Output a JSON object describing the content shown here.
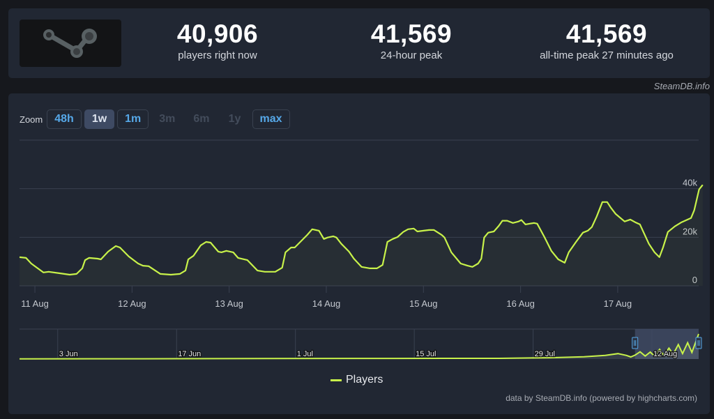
{
  "stats": [
    {
      "value": "40,906",
      "label": "players right now"
    },
    {
      "value": "41,569",
      "label": "24-hour peak"
    },
    {
      "value": "41,569",
      "label": "all-time peak 27 minutes ago"
    }
  ],
  "logo": {
    "icon": "steam-logo-icon"
  },
  "credit_top": "SteamDB.info",
  "zoom": {
    "label": "Zoom",
    "buttons": [
      {
        "label": "48h",
        "state": "enabled"
      },
      {
        "label": "1w",
        "state": "active"
      },
      {
        "label": "1m",
        "state": "enabled"
      },
      {
        "label": "3m",
        "state": "disabled"
      },
      {
        "label": "6m",
        "state": "disabled"
      },
      {
        "label": "1y",
        "state": "disabled"
      },
      {
        "label": "max",
        "state": "enabled"
      }
    ]
  },
  "legend": {
    "label": "Players"
  },
  "credit_bottom": "data by SteamDB.info (powered by highcharts.com)",
  "colors": {
    "line": "#c8f24a",
    "grid": "#3a4150",
    "axis_text": "#c4c8cf",
    "nav_mask": "#3e4a63"
  },
  "chart_data": {
    "type": "line",
    "title": "",
    "xlabel": "",
    "ylabel": "",
    "series": [
      {
        "name": "Players",
        "color": "#c8f24a"
      }
    ],
    "x_unit": "hours since 11 Aug 00:00",
    "xlim": [
      -3.8,
      164.0
    ],
    "ylim": [
      0,
      60000
    ],
    "y_ticks": [
      {
        "value": 0,
        "label": "0"
      },
      {
        "value": 20000,
        "label": "20k"
      },
      {
        "value": 40000,
        "label": "40k"
      },
      {
        "value": 60000,
        "label": ""
      }
    ],
    "x_ticks": [
      {
        "value": 0,
        "label": "11 Aug"
      },
      {
        "value": 24,
        "label": "12 Aug"
      },
      {
        "value": 48,
        "label": "13 Aug"
      },
      {
        "value": 72,
        "label": "14 Aug"
      },
      {
        "value": 96,
        "label": "15 Aug"
      },
      {
        "value": 120,
        "label": "16 Aug"
      },
      {
        "value": 144,
        "label": "17 Aug"
      }
    ],
    "grid": true,
    "legend_position": "bottom-center",
    "points": [
      [
        -3.8,
        11800
      ],
      [
        -2.2,
        11500
      ],
      [
        -0.9,
        9200
      ],
      [
        2.1,
        5500
      ],
      [
        3.4,
        5800
      ],
      [
        6.0,
        5200
      ],
      [
        8.6,
        4600
      ],
      [
        10.3,
        4900
      ],
      [
        11.7,
        7200
      ],
      [
        12.4,
        10600
      ],
      [
        13.4,
        11500
      ],
      [
        15.5,
        11200
      ],
      [
        16.3,
        10900
      ],
      [
        18.1,
        14100
      ],
      [
        20.0,
        16400
      ],
      [
        21.0,
        15800
      ],
      [
        23.2,
        12100
      ],
      [
        25.5,
        9200
      ],
      [
        26.7,
        8300
      ],
      [
        28.1,
        8100
      ],
      [
        31.0,
        4900
      ],
      [
        33.6,
        4600
      ],
      [
        35.8,
        4900
      ],
      [
        37.2,
        6300
      ],
      [
        37.9,
        10900
      ],
      [
        39.2,
        12400
      ],
      [
        41.0,
        16700
      ],
      [
        42.3,
        18100
      ],
      [
        43.4,
        17800
      ],
      [
        45.3,
        14100
      ],
      [
        46.1,
        13800
      ],
      [
        47.3,
        14400
      ],
      [
        49.0,
        13800
      ],
      [
        50.2,
        11500
      ],
      [
        52.5,
        10600
      ],
      [
        55.0,
        6300
      ],
      [
        56.8,
        5800
      ],
      [
        59.4,
        5800
      ],
      [
        61.1,
        7500
      ],
      [
        61.9,
        13800
      ],
      [
        63.3,
        15800
      ],
      [
        64.2,
        15800
      ],
      [
        67.3,
        21000
      ],
      [
        68.5,
        23300
      ],
      [
        70.2,
        22700
      ],
      [
        71.4,
        19300
      ],
      [
        72.3,
        19900
      ],
      [
        73.7,
        20400
      ],
      [
        74.5,
        19900
      ],
      [
        75.7,
        17300
      ],
      [
        77.6,
        14100
      ],
      [
        78.8,
        11200
      ],
      [
        80.7,
        7800
      ],
      [
        82.8,
        7200
      ],
      [
        84.5,
        7200
      ],
      [
        85.9,
        8600
      ],
      [
        87.1,
        18100
      ],
      [
        88.4,
        19300
      ],
      [
        89.6,
        20100
      ],
      [
        91.0,
        22200
      ],
      [
        92.2,
        23300
      ],
      [
        93.6,
        23600
      ],
      [
        94.5,
        22400
      ],
      [
        96.0,
        22700
      ],
      [
        97.4,
        23000
      ],
      [
        98.6,
        23000
      ],
      [
        100.5,
        21000
      ],
      [
        101.2,
        19900
      ],
      [
        102.9,
        13800
      ],
      [
        105.2,
        9200
      ],
      [
        106.9,
        8300
      ],
      [
        108.1,
        7800
      ],
      [
        109.5,
        9200
      ],
      [
        110.3,
        11200
      ],
      [
        111.0,
        19900
      ],
      [
        112.0,
        21900
      ],
      [
        113.4,
        22400
      ],
      [
        114.6,
        24700
      ],
      [
        115.5,
        26800
      ],
      [
        116.7,
        26800
      ],
      [
        118.1,
        25900
      ],
      [
        119.5,
        26500
      ],
      [
        120.2,
        27100
      ],
      [
        121.2,
        25300
      ],
      [
        123.3,
        25900
      ],
      [
        124.1,
        25600
      ],
      [
        125.9,
        20100
      ],
      [
        127.6,
        14400
      ],
      [
        129.3,
        10900
      ],
      [
        130.9,
        9500
      ],
      [
        131.9,
        13800
      ],
      [
        133.7,
        18100
      ],
      [
        135.4,
        21900
      ],
      [
        136.6,
        22700
      ],
      [
        137.6,
        24200
      ],
      [
        138.8,
        28500
      ],
      [
        140.2,
        34500
      ],
      [
        141.4,
        34500
      ],
      [
        142.3,
        32200
      ],
      [
        143.5,
        29600
      ],
      [
        145.7,
        26500
      ],
      [
        147.1,
        27300
      ],
      [
        148.3,
        26200
      ],
      [
        149.5,
        25300
      ],
      [
        151.7,
        17300
      ],
      [
        153.1,
        13800
      ],
      [
        154.3,
        11800
      ],
      [
        155.2,
        15800
      ],
      [
        156.4,
        22200
      ],
      [
        158.1,
        24500
      ],
      [
        159.8,
        26200
      ],
      [
        162.1,
        27900
      ],
      [
        162.9,
        31100
      ],
      [
        164.1,
        39700
      ],
      [
        165.0,
        41569
      ]
    ]
  },
  "navigator": {
    "x_unit": "days since 3 Jun",
    "xlim": [
      -4.5,
      75.5
    ],
    "x_ticks": [
      {
        "value": 0,
        "label": "3 Jun"
      },
      {
        "value": 14,
        "label": "17 Jun"
      },
      {
        "value": 28,
        "label": "1 Jul"
      },
      {
        "value": 42,
        "label": "15 Jul"
      },
      {
        "value": 56,
        "label": "29 Jul"
      },
      {
        "value": 70,
        "label": "12 Aug"
      }
    ],
    "selected_range": [
      68.0,
      75.5
    ],
    "points": [
      [
        -4.5,
        300
      ],
      [
        10,
        500
      ],
      [
        25,
        800
      ],
      [
        40,
        1000
      ],
      [
        52,
        1200
      ],
      [
        58,
        2200
      ],
      [
        62,
        3800
      ],
      [
        64.5,
        6000
      ],
      [
        66,
        9000
      ],
      [
        67,
        6000
      ],
      [
        67.5,
        3500
      ],
      [
        68,
        6500
      ],
      [
        68.6,
        12000
      ],
      [
        69.2,
        5000
      ],
      [
        69.8,
        11500
      ],
      [
        70.3,
        4800
      ],
      [
        70.9,
        16000
      ],
      [
        71.4,
        6000
      ],
      [
        72,
        18000
      ],
      [
        72.5,
        8000
      ],
      [
        73.1,
        24000
      ],
      [
        73.6,
        9000
      ],
      [
        74.2,
        27000
      ],
      [
        74.7,
        11000
      ],
      [
        75.5,
        41569
      ]
    ],
    "ylim": [
      0,
      45000
    ]
  }
}
